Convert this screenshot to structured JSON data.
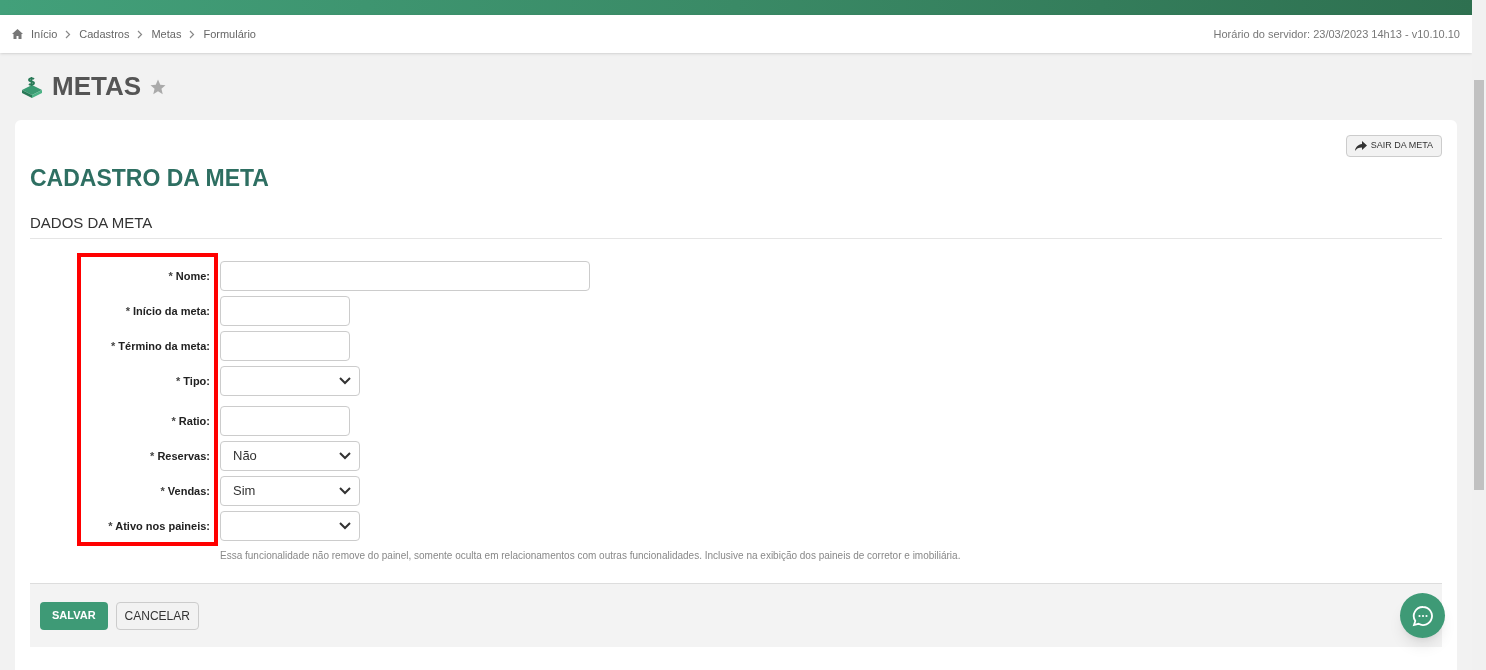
{
  "breadcrumb": [
    "Início",
    "Cadastros",
    "Metas",
    "Formulário"
  ],
  "server_time": "Horário do servidor: 23/03/2023 14h13 - v10.10.10",
  "page_title": "METAS",
  "exit_button": "SAIR DA META",
  "form_title": "CADASTRO DA META",
  "section_title": "DADOS DA META",
  "fields": [
    {
      "kind": "wide",
      "asterisk": "*",
      "label": "Nome:"
    },
    {
      "kind": "text",
      "asterisk": "*",
      "label": "Início da meta:"
    },
    {
      "kind": "text",
      "asterisk": "*",
      "label": "Término da meta:"
    },
    {
      "kind": "select",
      "asterisk": "*",
      "label": "Tipo:"
    },
    {
      "kind": "text",
      "asterisk": "*",
      "label": "Ratio:"
    },
    {
      "kind": "select",
      "asterisk": "*",
      "label": "Reservas:",
      "value": "Não"
    },
    {
      "kind": "select",
      "asterisk": "*",
      "label": "Vendas:",
      "value": "Sim"
    },
    {
      "kind": "select",
      "asterisk": "*",
      "label": "Ativo nos paineis:"
    }
  ],
  "help_text": "Essa funcionalidade não remove do painel, somente oculta em relacionamentos com outras funcionalidades. Inclusive na exibição dos paineis de corretor e imobiliária.",
  "buttons": [
    {
      "label": "SALVAR",
      "kind": "primary"
    },
    {
      "label": "CANCELAR",
      "kind": "secondary"
    }
  ]
}
